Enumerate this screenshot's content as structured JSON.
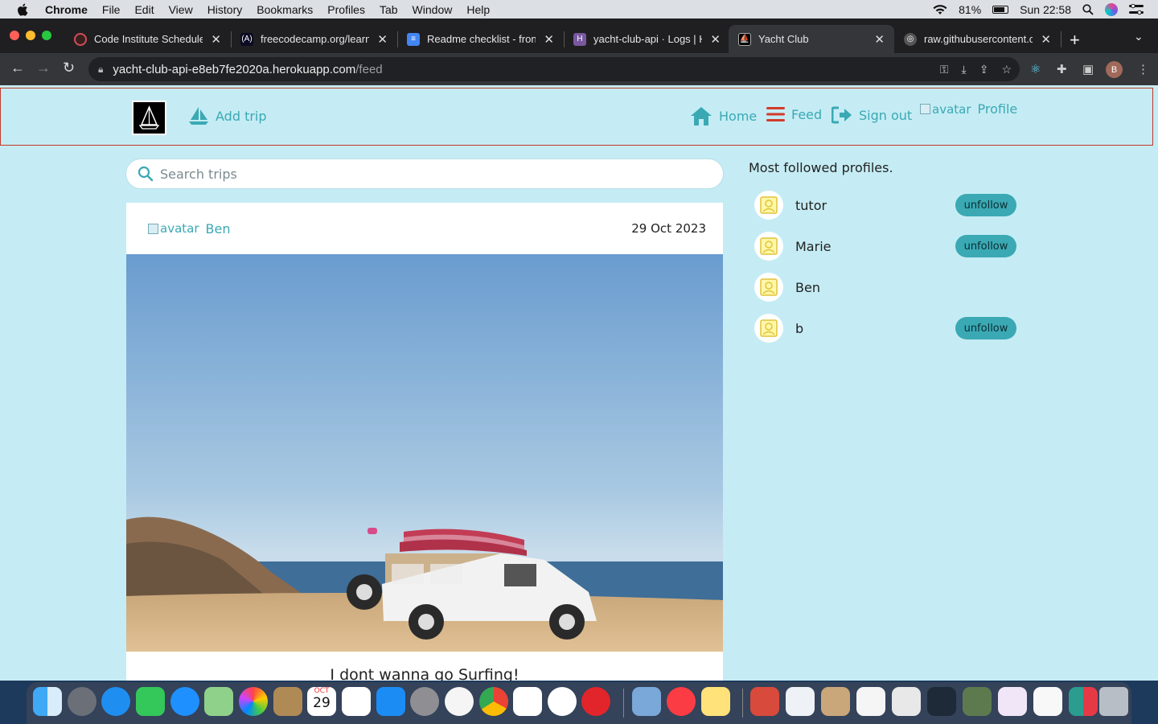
{
  "menubar": {
    "app_name": "Chrome",
    "items": [
      "File",
      "Edit",
      "View",
      "History",
      "Bookmarks",
      "Profiles",
      "Tab",
      "Window",
      "Help"
    ],
    "battery": "81%",
    "clock": "Sun 22:58"
  },
  "tabs": [
    {
      "title": "Code Institute Schedule",
      "icon": "code-institute-icon",
      "color": "#d24d57"
    },
    {
      "title": "freecodecamp.org/learn/",
      "icon": "freecodecamp-icon",
      "color": "#0a0a23"
    },
    {
      "title": "Readme checklist - front",
      "icon": "google-docs-icon",
      "color": "#4285f4"
    },
    {
      "title": "yacht-club-api · Logs | H",
      "icon": "heroku-icon",
      "color": "#79589f"
    },
    {
      "title": "Yacht Club",
      "icon": "yacht-club-favicon",
      "color": "#000000",
      "active": true
    },
    {
      "title": "raw.githubusercontent.c",
      "icon": "globe-icon",
      "color": "#888888"
    }
  ],
  "address": {
    "host": "yacht-club-api-e8eb7fe2020a.herokuapp.com",
    "path": "/feed"
  },
  "profile_initial": "B",
  "navbar": {
    "add_trip": "Add trip",
    "home": "Home",
    "feed": "Feed",
    "sign_out": "Sign out",
    "avatar_alt": "avatar",
    "profile": "Profile"
  },
  "search": {
    "placeholder": "Search trips"
  },
  "post": {
    "avatar_alt": "avatar",
    "author": "Ben",
    "date": "29 Oct 2023",
    "title": "I dont wanna go Surfing!"
  },
  "sidebar": {
    "title": "Most followed profiles.",
    "button_label": "unfollow",
    "profiles": [
      {
        "name": "tutor",
        "following": true
      },
      {
        "name": "Marie",
        "following": true
      },
      {
        "name": "Ben",
        "following": false
      },
      {
        "name": "b",
        "following": true
      }
    ]
  },
  "colors": {
    "accent": "#3aa9b4",
    "page_bg": "#c5ecf4",
    "feed_icon": "#d23b2a"
  },
  "dock": {
    "calendar_month": "OCT",
    "calendar_day": "29"
  }
}
